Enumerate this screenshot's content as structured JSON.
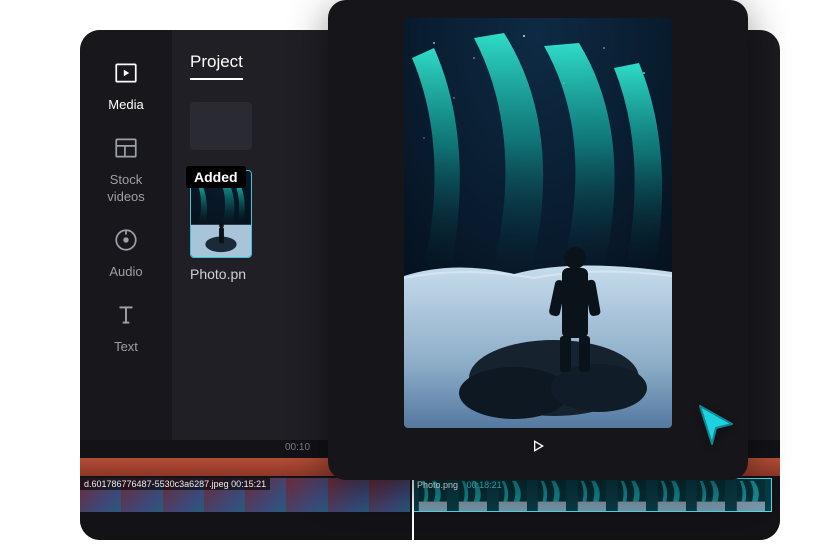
{
  "sidebar": {
    "items": [
      {
        "label": "Media"
      },
      {
        "label": "Stock\nvideos"
      },
      {
        "label": "Audio"
      },
      {
        "label": "Text"
      }
    ]
  },
  "panel": {
    "tabs": [
      {
        "label": "Project"
      }
    ],
    "badge": "Added",
    "filename": "Photo.pn"
  },
  "timeline": {
    "ruler": [
      "00:10"
    ],
    "clip1_label": "d.601786776487-5530c3a6287.jpeg   00:15:21",
    "clip2_filename": "Photo.png",
    "clip2_timecode": "00:18:21"
  },
  "colors": {
    "accent": "#1fd1e0",
    "orange_track": "#b34d38"
  }
}
